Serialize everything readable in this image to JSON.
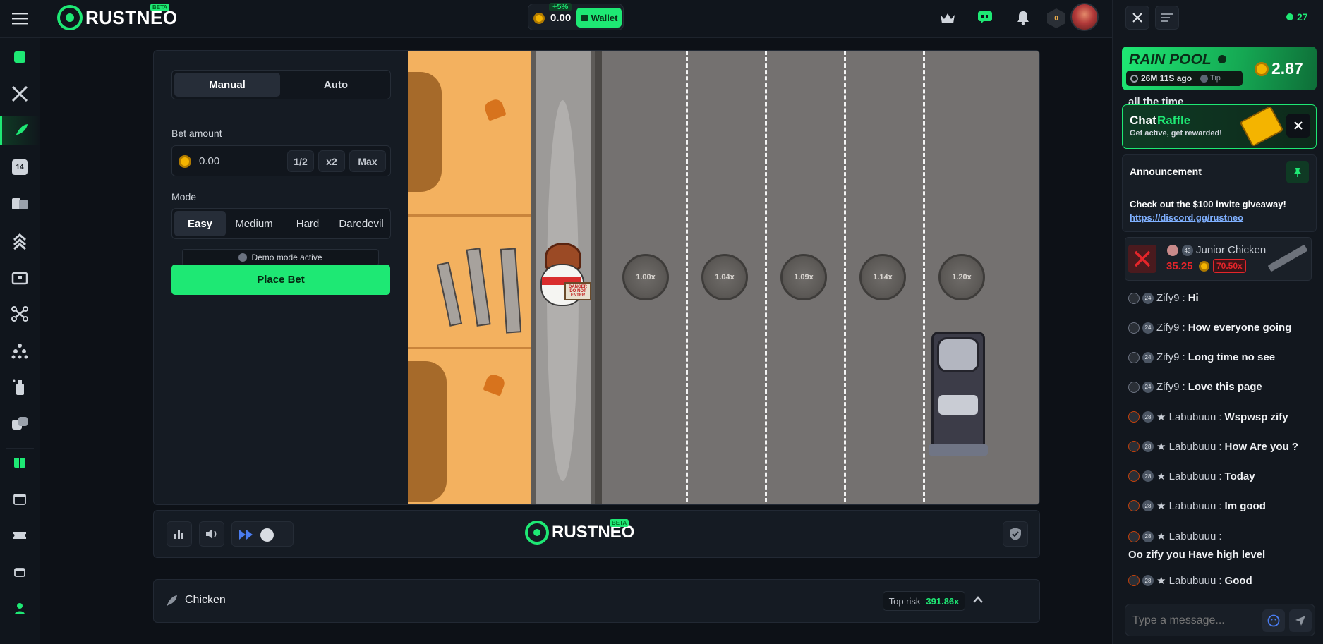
{
  "topbar": {
    "brand": "RUSTNEO",
    "beta": "BETA",
    "bonus": "+5%",
    "balance": "0.00",
    "wallet_label": "Wallet",
    "level_badge": "0"
  },
  "game": {
    "tabs": [
      "Manual",
      "Auto"
    ],
    "bet_amount_label": "Bet amount",
    "bet_value": "0.00",
    "half_label": "1/2",
    "double_label": "x2",
    "max_label": "Max",
    "mode_label": "Mode",
    "modes": [
      "Easy",
      "Medium",
      "Hard",
      "Daredevil"
    ],
    "demo_notice": "Demo mode active",
    "place_bet_label": "Place Bet",
    "multipliers": [
      "1.00x",
      "1.04x",
      "1.09x",
      "1.14x",
      "1.20x"
    ],
    "sign_text": "DANGER DO NOT ENTER",
    "footer_brand": "RUSTNEO",
    "footer_beta": "BETA"
  },
  "info_bar": {
    "title": "Chicken",
    "top_risk_label": "Top risk",
    "top_risk_value": "391.86x"
  },
  "chat": {
    "online_count": "27",
    "rain_pool": {
      "title": "RAIN POOL",
      "amount": "2.87",
      "time": "26M 11S ago",
      "tip_label": "Tip"
    },
    "partial_text": "all the time",
    "raffle": {
      "title_a": "Chat",
      "title_b": "Raffle",
      "subtitle": "Get active, get rewarded!"
    },
    "announcement": {
      "title": "Announcement",
      "body": "Check out the $100 invite giveaway!",
      "link": "https://discord.gg/rustneo"
    },
    "win_card": {
      "user": "Junior Chicken",
      "level": "43",
      "amount": "35.25",
      "multiplier": "70.50x"
    },
    "messages": [
      {
        "level": "24",
        "user": "Zify9",
        "text": "Hi"
      },
      {
        "level": "24",
        "user": "Zify9",
        "text": "How everyone going"
      },
      {
        "level": "24",
        "user": "Zify9",
        "text": "Long time no see"
      },
      {
        "level": "24",
        "user": "Zify9",
        "text": "Love this page"
      },
      {
        "level": "28",
        "user": "★ Labubuuu",
        "text": "Wspwsp zify"
      },
      {
        "level": "28",
        "user": "★ Labubuuu",
        "text": "How Are you ?"
      },
      {
        "level": "28",
        "user": "★ Labubuuu",
        "text": "Today"
      },
      {
        "level": "28",
        "user": "★ Labubuuu",
        "text": "Im good"
      },
      {
        "level": "28",
        "user": "★ Labubuuu",
        "text": "Oo zify you Have high level"
      },
      {
        "level": "28",
        "user": "★ Labubuuu",
        "text": "Good"
      }
    ],
    "input_placeholder": "Type a message..."
  },
  "colors": {
    "accent": "#1ee874",
    "background": "#0d1117",
    "danger": "#e5252a",
    "road": "#747170",
    "sand": "#f3b15f"
  }
}
